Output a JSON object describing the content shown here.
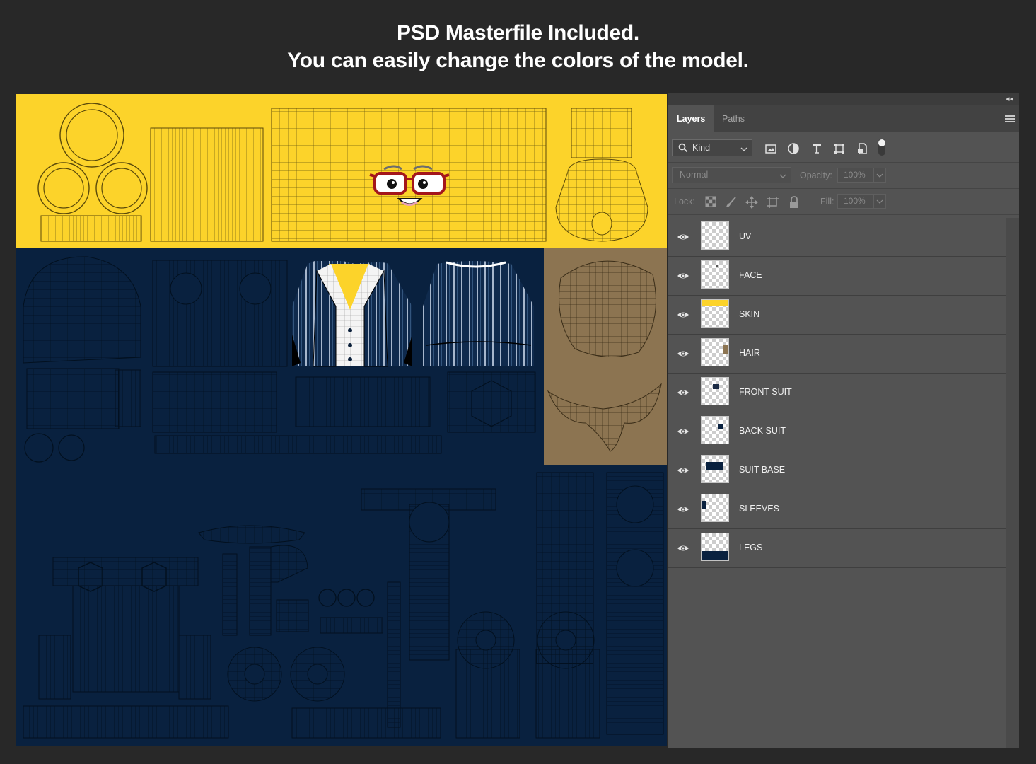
{
  "headline": {
    "line1": "PSD Masterfile Included.",
    "line2": "You can easily change the colors of the model."
  },
  "colors": {
    "skin": "#fcd32a",
    "suit": "#09213f",
    "hair": "#8c7451",
    "glasses": "#a3161c",
    "panel_bg": "#535353"
  },
  "panel": {
    "tabs": [
      {
        "label": "Layers",
        "active": true
      },
      {
        "label": "Paths",
        "active": false
      }
    ],
    "filter": {
      "kind_label": "Kind",
      "icons": [
        "image-filter-icon",
        "adjustment-filter-icon",
        "type-filter-icon",
        "shape-filter-icon",
        "smart-object-filter-icon",
        "filter-toggle-icon"
      ]
    },
    "blend": {
      "mode": "Normal",
      "opacity_label": "Opacity:",
      "opacity_value": "100%"
    },
    "lock": {
      "label": "Lock:",
      "icons": [
        "lock-transparent-pixels-icon",
        "lock-image-pixels-icon",
        "lock-position-icon",
        "lock-artboard-icon",
        "lock-all-icon"
      ],
      "fill_label": "Fill:",
      "fill_value": "100%"
    },
    "layers": [
      {
        "name": "UV",
        "visible": true
      },
      {
        "name": "FACE",
        "visible": true
      },
      {
        "name": "SKIN",
        "visible": true
      },
      {
        "name": "HAIR",
        "visible": true
      },
      {
        "name": "FRONT SUIT",
        "visible": true
      },
      {
        "name": "BACK SUIT",
        "visible": true
      },
      {
        "name": "SUIT BASE",
        "visible": true
      },
      {
        "name": "SLEEVES",
        "visible": true
      },
      {
        "name": "LEGS",
        "visible": true
      }
    ]
  }
}
